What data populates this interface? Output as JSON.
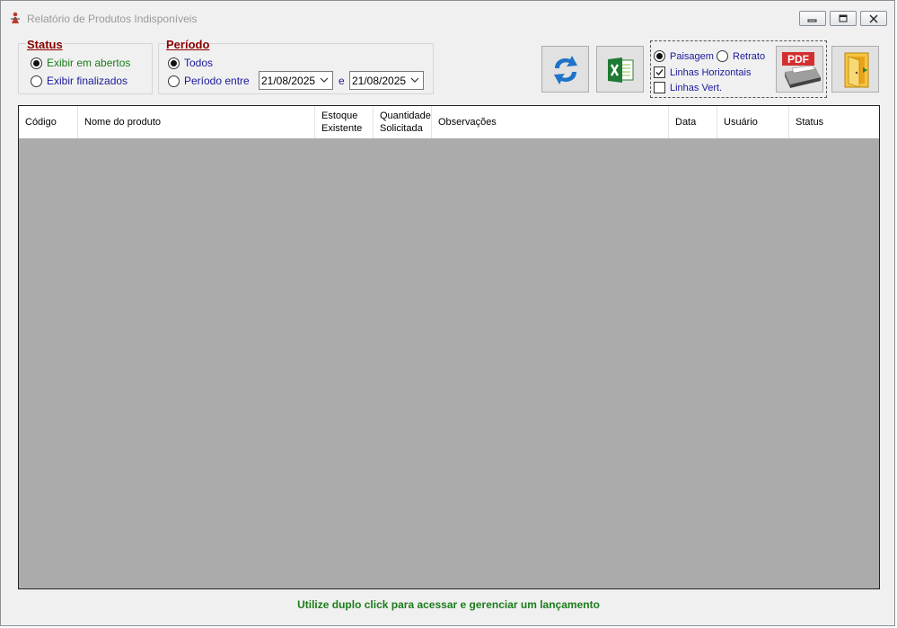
{
  "window": {
    "title": "Relatório de Produtos Indisponíveis"
  },
  "status_group": {
    "title": "Status",
    "options": [
      {
        "label": "Exibir em abertos",
        "selected": true,
        "color": "#1b7d1b"
      },
      {
        "label": "Exibir finalizados",
        "selected": false,
        "color": "#1a1a9c"
      }
    ]
  },
  "period_group": {
    "title": "Período",
    "options": [
      {
        "label": "Todos",
        "selected": true
      },
      {
        "label": "Período entre",
        "selected": false
      }
    ],
    "date_from": "21/08/2025",
    "separator": "e",
    "date_to": "21/08/2025"
  },
  "toolbar": {
    "refresh_icon": "refresh-arrows-icon",
    "excel_icon": "excel-icon",
    "pdf_icon": "pdf-printer-icon",
    "pdf_label": "PDF",
    "exit_icon": "exit-door-icon"
  },
  "print_options": {
    "orientation": [
      {
        "label": "Paisagem",
        "selected": true
      },
      {
        "label": "Retrato",
        "selected": false
      }
    ],
    "horizontal_lines": {
      "label": "Linhas Horizontais",
      "checked": true
    },
    "vertical_lines": {
      "label": "Linhas Vert.",
      "checked": false
    }
  },
  "grid": {
    "columns": [
      "Código",
      "Nome do produto",
      "Estoque\nExistente",
      "Quantidade\nSolicitada",
      "Observações",
      "Data",
      "Usuário",
      "Status"
    ],
    "rows": []
  },
  "footer": {
    "hint": "Utilize duplo click para acessar e gerenciar um lançamento"
  },
  "colors": {
    "accent_title": "#8b0000",
    "green_text": "#1b7d1b",
    "blue_text": "#1a1a9c",
    "grid_background": "#ababab"
  }
}
